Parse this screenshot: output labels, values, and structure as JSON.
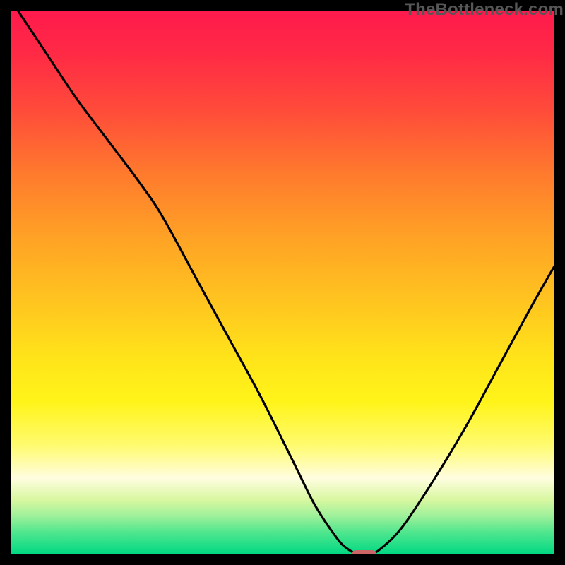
{
  "watermark": "TheBottleneck.com",
  "chart_data": {
    "type": "line",
    "title": "",
    "xlabel": "",
    "ylabel": "",
    "xlim": [
      0,
      100
    ],
    "ylim": [
      0,
      100
    ],
    "series": [
      {
        "name": "bottleneck-curve",
        "x": [
          0,
          6,
          12,
          18,
          24,
          28,
          34,
          40,
          46,
          52,
          56,
          60,
          62,
          64,
          66,
          68,
          72,
          78,
          84,
          90,
          96,
          100
        ],
        "y": [
          102,
          93,
          84,
          76,
          68,
          62,
          51,
          40,
          29,
          17,
          9,
          3,
          1,
          0,
          0,
          1,
          5,
          14,
          24,
          35,
          46,
          53
        ]
      }
    ],
    "marker": {
      "x": 65,
      "y": 0,
      "w": 4.5,
      "h": 1.6
    },
    "gradient_stops": [
      {
        "pos": 0,
        "color": "#ff1a4d"
      },
      {
        "pos": 50,
        "color": "#ffc61f"
      },
      {
        "pos": 80,
        "color": "#fffb70"
      },
      {
        "pos": 100,
        "color": "#00d882"
      }
    ]
  }
}
